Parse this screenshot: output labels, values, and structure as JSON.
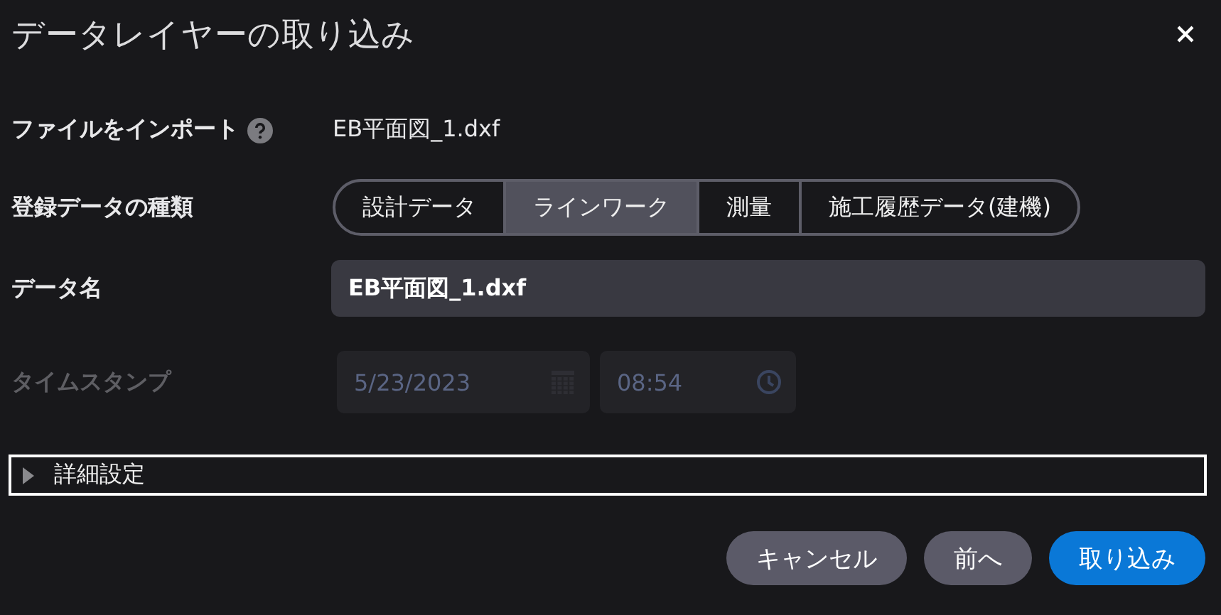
{
  "window": {
    "title": "データレイヤーの取り込み"
  },
  "import": {
    "label": "ファイルをインポート",
    "file_name": "EB平面図_1.dxf"
  },
  "data_type": {
    "label": "登録データの種類",
    "options": [
      {
        "label": "設計データ",
        "selected": false
      },
      {
        "label": "ラインワーク",
        "selected": true
      },
      {
        "label": "測量",
        "selected": false
      },
      {
        "label": "施工履歴データ(建機)",
        "selected": false
      }
    ]
  },
  "data_name": {
    "label": "データ名",
    "value": "EB平面図_1.dxf"
  },
  "timestamp": {
    "label": "タイムスタンプ",
    "disabled": true,
    "date": "5/23/2023",
    "time": "08:54"
  },
  "details": {
    "label": "詳細設定",
    "expanded": false
  },
  "buttons": [
    {
      "label": "キャンセル",
      "kind": "secondary"
    },
    {
      "label": "前へ",
      "kind": "secondary"
    },
    {
      "label": "取り込み",
      "kind": "primary"
    }
  ]
}
